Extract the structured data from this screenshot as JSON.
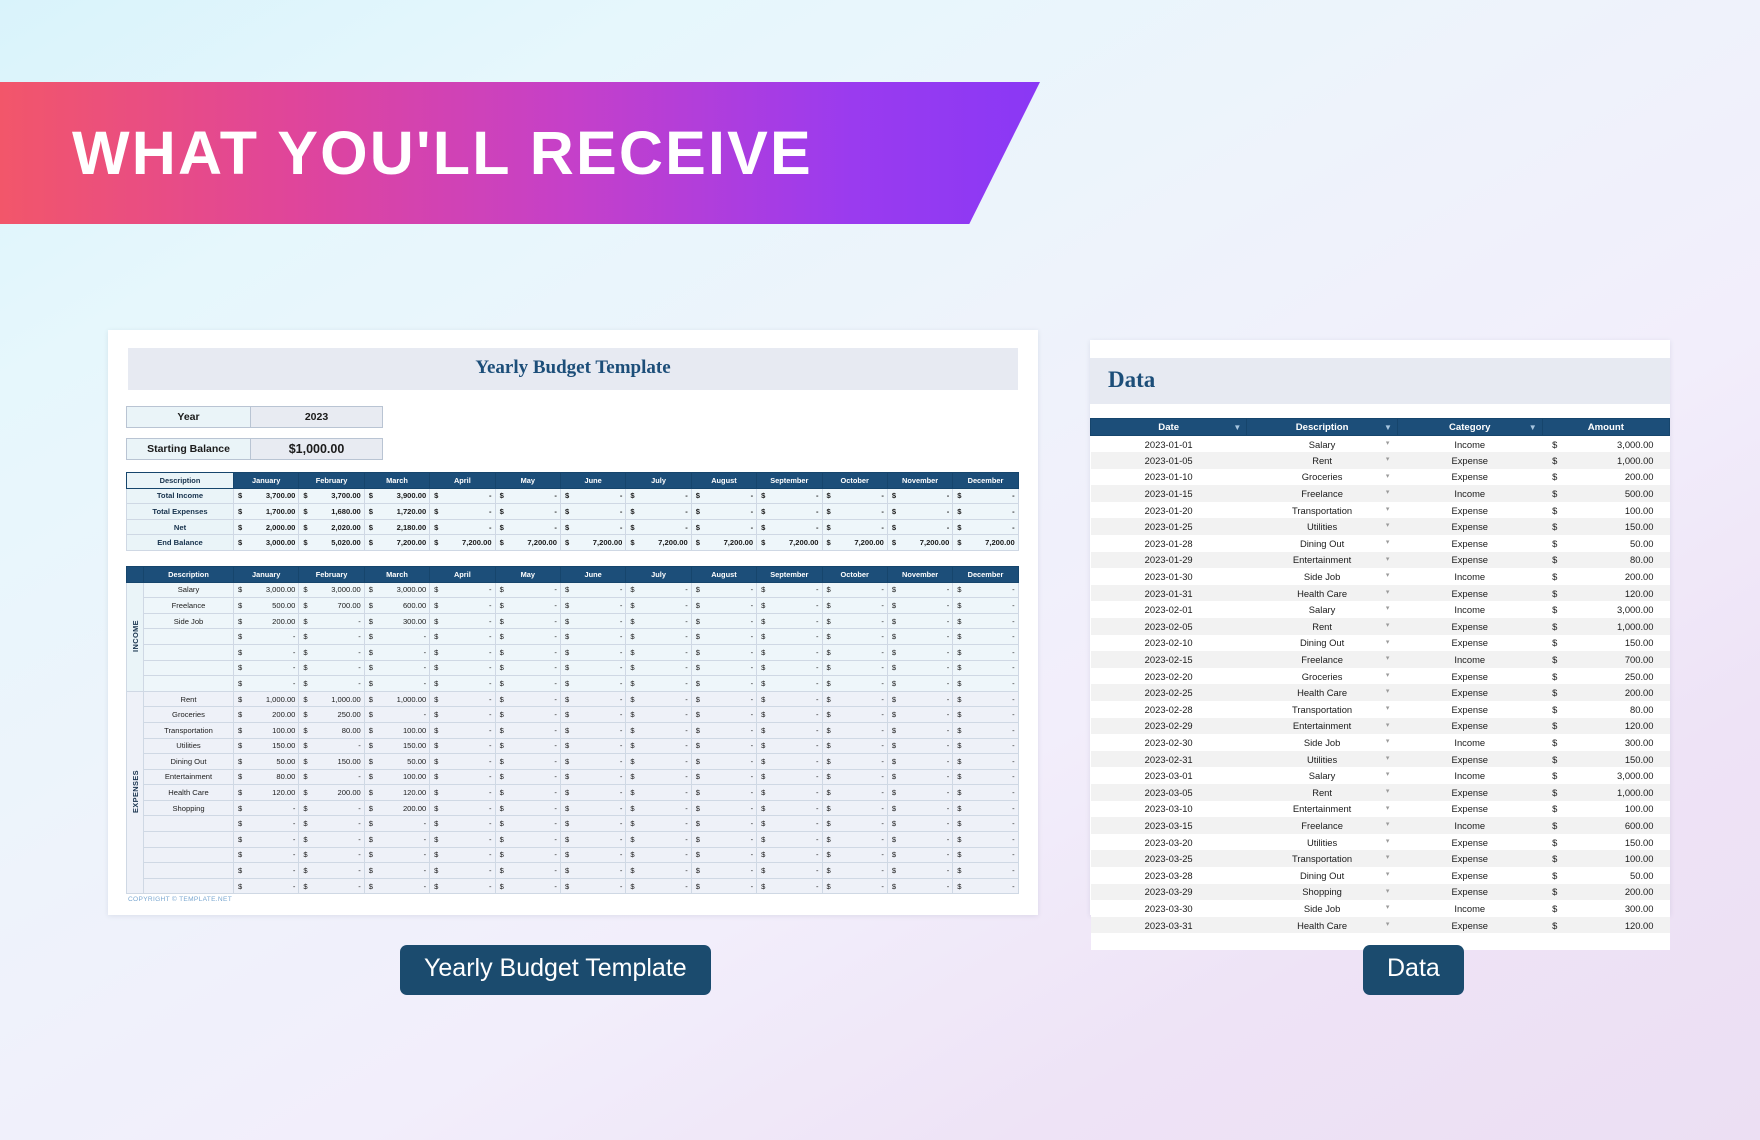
{
  "banner": {
    "title": "WHAT YOU'LL RECEIVE",
    "gradient_start": "#f2566a",
    "gradient_end": "#8a38f5"
  },
  "accent_color": "#1c4e79",
  "budget_sheet": {
    "title": "Yearly Budget Template",
    "meta": [
      {
        "label": "Year",
        "value": "2023"
      },
      {
        "label": "Starting Balance",
        "value": "$1,000.00"
      }
    ],
    "months": [
      "January",
      "February",
      "March",
      "April",
      "May",
      "June",
      "July",
      "August",
      "September",
      "October",
      "November",
      "December"
    ],
    "description_header": "Description",
    "summary_rows": [
      {
        "label": "Total Income",
        "values": [
          "3,700.00",
          "3,700.00",
          "3,900.00",
          "-",
          "-",
          "-",
          "-",
          "-",
          "-",
          "-",
          "-",
          "-"
        ]
      },
      {
        "label": "Total Expenses",
        "values": [
          "1,700.00",
          "1,680.00",
          "1,720.00",
          "-",
          "-",
          "-",
          "-",
          "-",
          "-",
          "-",
          "-",
          "-"
        ]
      },
      {
        "label": "Net",
        "values": [
          "2,000.00",
          "2,020.00",
          "2,180.00",
          "-",
          "-",
          "-",
          "-",
          "-",
          "-",
          "-",
          "-",
          "-"
        ]
      },
      {
        "label": "End Balance",
        "values": [
          "3,000.00",
          "5,020.00",
          "7,200.00",
          "7,200.00",
          "7,200.00",
          "7,200.00",
          "7,200.00",
          "7,200.00",
          "7,200.00",
          "7,200.00",
          "7,200.00",
          "7,200.00"
        ]
      }
    ],
    "income_section_label": "INCOME",
    "income_rows": [
      {
        "label": "Salary",
        "values": [
          "3,000.00",
          "3,000.00",
          "3,000.00",
          "-",
          "-",
          "-",
          "-",
          "-",
          "-",
          "-",
          "-",
          "-"
        ]
      },
      {
        "label": "Freelance",
        "values": [
          "500.00",
          "700.00",
          "600.00",
          "-",
          "-",
          "-",
          "-",
          "-",
          "-",
          "-",
          "-",
          "-"
        ]
      },
      {
        "label": "Side Job",
        "values": [
          "200.00",
          "-",
          "300.00",
          "-",
          "-",
          "-",
          "-",
          "-",
          "-",
          "-",
          "-",
          "-"
        ]
      },
      {
        "label": "",
        "values": [
          "-",
          "-",
          "-",
          "-",
          "-",
          "-",
          "-",
          "-",
          "-",
          "-",
          "-",
          "-"
        ]
      },
      {
        "label": "",
        "values": [
          "-",
          "-",
          "-",
          "-",
          "-",
          "-",
          "-",
          "-",
          "-",
          "-",
          "-",
          "-"
        ]
      },
      {
        "label": "",
        "values": [
          "-",
          "-",
          "-",
          "-",
          "-",
          "-",
          "-",
          "-",
          "-",
          "-",
          "-",
          "-"
        ]
      },
      {
        "label": "",
        "values": [
          "-",
          "-",
          "-",
          "-",
          "-",
          "-",
          "-",
          "-",
          "-",
          "-",
          "-",
          "-"
        ]
      }
    ],
    "expenses_section_label": "EXPENSES",
    "expense_rows": [
      {
        "label": "Rent",
        "values": [
          "1,000.00",
          "1,000.00",
          "1,000.00",
          "-",
          "-",
          "-",
          "-",
          "-",
          "-",
          "-",
          "-",
          "-"
        ]
      },
      {
        "label": "Groceries",
        "values": [
          "200.00",
          "250.00",
          "-",
          "-",
          "-",
          "-",
          "-",
          "-",
          "-",
          "-",
          "-",
          "-"
        ]
      },
      {
        "label": "Transportation",
        "values": [
          "100.00",
          "80.00",
          "100.00",
          "-",
          "-",
          "-",
          "-",
          "-",
          "-",
          "-",
          "-",
          "-"
        ]
      },
      {
        "label": "Utilities",
        "values": [
          "150.00",
          "-",
          "150.00",
          "-",
          "-",
          "-",
          "-",
          "-",
          "-",
          "-",
          "-",
          "-"
        ]
      },
      {
        "label": "Dining Out",
        "values": [
          "50.00",
          "150.00",
          "50.00",
          "-",
          "-",
          "-",
          "-",
          "-",
          "-",
          "-",
          "-",
          "-"
        ]
      },
      {
        "label": "Entertainment",
        "values": [
          "80.00",
          "-",
          "100.00",
          "-",
          "-",
          "-",
          "-",
          "-",
          "-",
          "-",
          "-",
          "-"
        ]
      },
      {
        "label": "Health Care",
        "values": [
          "120.00",
          "200.00",
          "120.00",
          "-",
          "-",
          "-",
          "-",
          "-",
          "-",
          "-",
          "-",
          "-"
        ]
      },
      {
        "label": "Shopping",
        "values": [
          "-",
          "-",
          "200.00",
          "-",
          "-",
          "-",
          "-",
          "-",
          "-",
          "-",
          "-",
          "-"
        ]
      },
      {
        "label": "",
        "values": [
          "-",
          "-",
          "-",
          "-",
          "-",
          "-",
          "-",
          "-",
          "-",
          "-",
          "-",
          "-"
        ]
      },
      {
        "label": "",
        "values": [
          "-",
          "-",
          "-",
          "-",
          "-",
          "-",
          "-",
          "-",
          "-",
          "-",
          "-",
          "-"
        ]
      },
      {
        "label": "",
        "values": [
          "-",
          "-",
          "-",
          "-",
          "-",
          "-",
          "-",
          "-",
          "-",
          "-",
          "-",
          "-"
        ]
      },
      {
        "label": "",
        "values": [
          "-",
          "-",
          "-",
          "-",
          "-",
          "-",
          "-",
          "-",
          "-",
          "-",
          "-",
          "-"
        ]
      },
      {
        "label": "",
        "values": [
          "-",
          "-",
          "-",
          "-",
          "-",
          "-",
          "-",
          "-",
          "-",
          "-",
          "-",
          "-"
        ]
      }
    ],
    "currency_symbol": "$",
    "copyright": "COPYRIGHT © TEMPLATE.NET"
  },
  "data_sheet": {
    "title": "Data",
    "columns": [
      "Date",
      "Description",
      "Category",
      "Amount"
    ],
    "currency_symbol": "$",
    "rows": [
      {
        "date": "2023-01-01",
        "description": "Salary",
        "category": "Income",
        "amount": "3,000.00"
      },
      {
        "date": "2023-01-05",
        "description": "Rent",
        "category": "Expense",
        "amount": "1,000.00"
      },
      {
        "date": "2023-01-10",
        "description": "Groceries",
        "category": "Expense",
        "amount": "200.00"
      },
      {
        "date": "2023-01-15",
        "description": "Freelance",
        "category": "Income",
        "amount": "500.00"
      },
      {
        "date": "2023-01-20",
        "description": "Transportation",
        "category": "Expense",
        "amount": "100.00"
      },
      {
        "date": "2023-01-25",
        "description": "Utilities",
        "category": "Expense",
        "amount": "150.00"
      },
      {
        "date": "2023-01-28",
        "description": "Dining Out",
        "category": "Expense",
        "amount": "50.00"
      },
      {
        "date": "2023-01-29",
        "description": "Entertainment",
        "category": "Expense",
        "amount": "80.00"
      },
      {
        "date": "2023-01-30",
        "description": "Side Job",
        "category": "Income",
        "amount": "200.00"
      },
      {
        "date": "2023-01-31",
        "description": "Health Care",
        "category": "Expense",
        "amount": "120.00"
      },
      {
        "date": "2023-02-01",
        "description": "Salary",
        "category": "Income",
        "amount": "3,000.00"
      },
      {
        "date": "2023-02-05",
        "description": "Rent",
        "category": "Expense",
        "amount": "1,000.00"
      },
      {
        "date": "2023-02-10",
        "description": "Dining Out",
        "category": "Expense",
        "amount": "150.00"
      },
      {
        "date": "2023-02-15",
        "description": "Freelance",
        "category": "Income",
        "amount": "700.00"
      },
      {
        "date": "2023-02-20",
        "description": "Groceries",
        "category": "Expense",
        "amount": "250.00"
      },
      {
        "date": "2023-02-25",
        "description": "Health Care",
        "category": "Expense",
        "amount": "200.00"
      },
      {
        "date": "2023-02-28",
        "description": "Transportation",
        "category": "Expense",
        "amount": "80.00"
      },
      {
        "date": "2023-02-29",
        "description": "Entertainment",
        "category": "Expense",
        "amount": "120.00"
      },
      {
        "date": "2023-02-30",
        "description": "Side Job",
        "category": "Income",
        "amount": "300.00"
      },
      {
        "date": "2023-02-31",
        "description": "Utilities",
        "category": "Expense",
        "amount": "150.00"
      },
      {
        "date": "2023-03-01",
        "description": "Salary",
        "category": "Income",
        "amount": "3,000.00"
      },
      {
        "date": "2023-03-05",
        "description": "Rent",
        "category": "Expense",
        "amount": "1,000.00"
      },
      {
        "date": "2023-03-10",
        "description": "Entertainment",
        "category": "Expense",
        "amount": "100.00"
      },
      {
        "date": "2023-03-15",
        "description": "Freelance",
        "category": "Income",
        "amount": "600.00"
      },
      {
        "date": "2023-03-20",
        "description": "Utilities",
        "category": "Expense",
        "amount": "150.00"
      },
      {
        "date": "2023-03-25",
        "description": "Transportation",
        "category": "Expense",
        "amount": "100.00"
      },
      {
        "date": "2023-03-28",
        "description": "Dining Out",
        "category": "Expense",
        "amount": "50.00"
      },
      {
        "date": "2023-03-29",
        "description": "Shopping",
        "category": "Expense",
        "amount": "200.00"
      },
      {
        "date": "2023-03-30",
        "description": "Side Job",
        "category": "Income",
        "amount": "300.00"
      },
      {
        "date": "2023-03-31",
        "description": "Health Care",
        "category": "Expense",
        "amount": "120.00"
      }
    ]
  },
  "pills": [
    {
      "label": "Yearly Budget Template"
    },
    {
      "label": "Data"
    }
  ]
}
